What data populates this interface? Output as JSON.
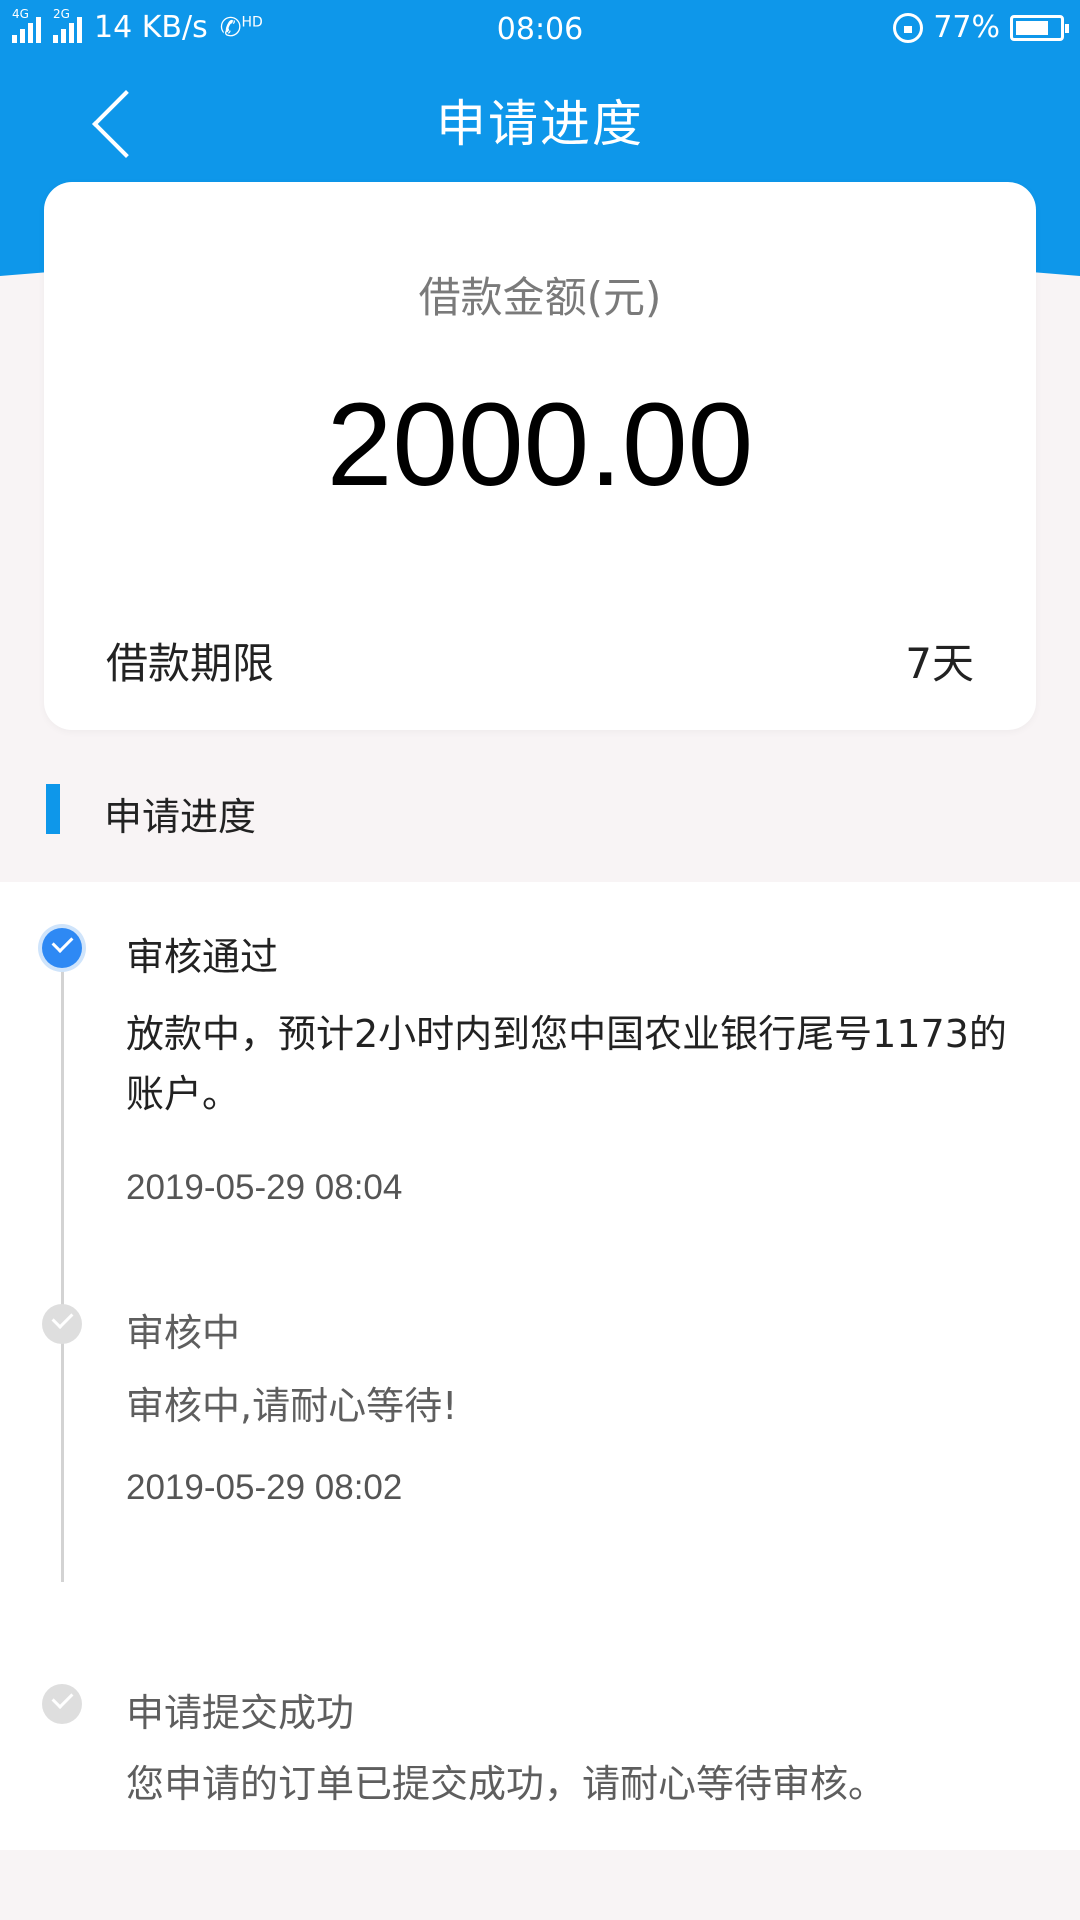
{
  "status_bar": {
    "network_4g": "4G",
    "network_2g": "2G",
    "speed": "14 KB/s",
    "hd": "HD",
    "time": "08:06",
    "battery": "77%",
    "battery_level": 0.77
  },
  "header": {
    "title": "申请进度",
    "back_icon": "chevron-left-icon"
  },
  "loan": {
    "amount_label": "借款金额(元)",
    "amount": "2000.00",
    "term_label": "借款期限",
    "term_value": "7天"
  },
  "progress": {
    "section_title": "申请进度",
    "steps": [
      {
        "title": "审核通过",
        "desc": "放款中，预计2小时内到您中国农业银行尾号1173的账户。",
        "time": "2019-05-29 08:04",
        "state": "done"
      },
      {
        "title": "审核中",
        "desc": "审核中,请耐心等待!",
        "time": "2019-05-29 08:02",
        "state": "inactive"
      },
      {
        "title": "申请提交成功",
        "desc": "您申请的订单已提交成功，请耐心等待审核。",
        "time": "",
        "state": "inactive"
      }
    ]
  },
  "colors": {
    "primary": "#0e97ea",
    "active_dot": "#2e89f4",
    "inactive_dot": "#dedede",
    "page_bg": "#f8f4f5"
  }
}
